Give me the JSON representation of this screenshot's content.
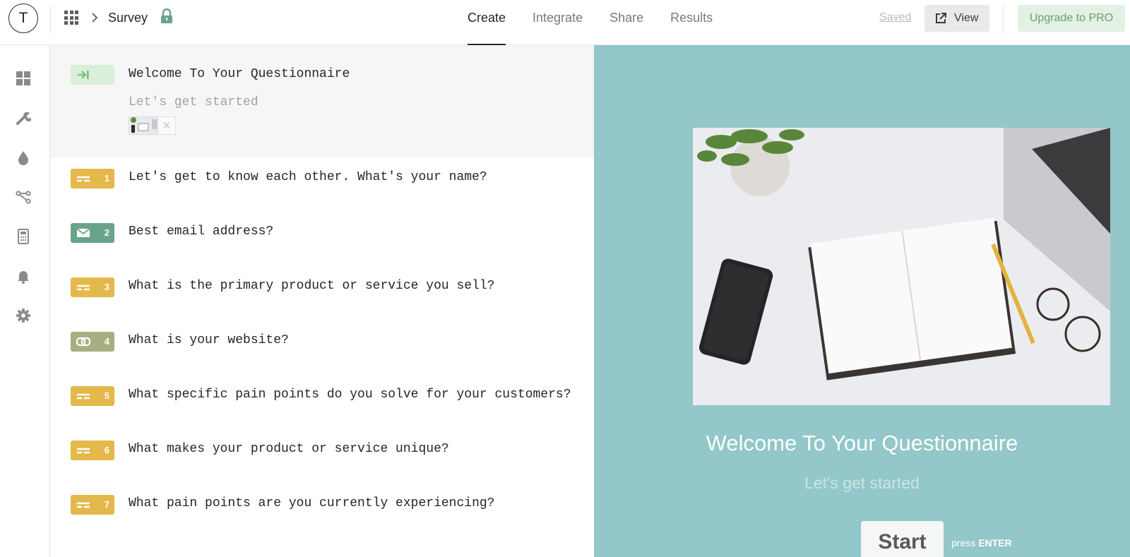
{
  "header": {
    "avatar_letter": "T",
    "breadcrumb_title": "Survey",
    "tabs": [
      {
        "label": "Create",
        "active": true
      },
      {
        "label": "Integrate",
        "active": false
      },
      {
        "label": "Share",
        "active": false
      },
      {
        "label": "Results",
        "active": false
      }
    ],
    "saved_label": "Saved",
    "view_label": "View",
    "upgrade_label": "Upgrade to PRO"
  },
  "sidebar": {
    "icons": [
      "dashboard-icon",
      "wrench-icon",
      "droplet-icon",
      "logic-icon",
      "calculator-icon",
      "bell-icon",
      "gear-icon"
    ]
  },
  "welcome_screen": {
    "title": "Welcome To Your Questionnaire",
    "subtitle": "Let's get started",
    "icon": "welcome-enter-icon",
    "color": "#d9efd8"
  },
  "questions": [
    {
      "number": "1",
      "text": "Let's get to know each other. What's your name?",
      "type_icon": "short-text-icon",
      "color": "#e4b84a"
    },
    {
      "number": "2",
      "text": "Best email address?",
      "type_icon": "email-icon",
      "color": "#6aa38b"
    },
    {
      "number": "3",
      "text": "What is the primary product or service you sell?",
      "type_icon": "short-text-icon",
      "color": "#e4b84a"
    },
    {
      "number": "4",
      "text": "What is your website?",
      "type_icon": "link-icon",
      "color": "#a9ad82"
    },
    {
      "number": "5",
      "text": "What specific pain points do you solve for your customers?",
      "type_icon": "short-text-icon",
      "color": "#e4b84a"
    },
    {
      "number": "6",
      "text": "What makes your product or service unique?",
      "type_icon": "short-text-icon",
      "color": "#e4b84a"
    },
    {
      "number": "7",
      "text": "What pain points are you currently experiencing?",
      "type_icon": "short-text-icon",
      "color": "#e4b84a"
    }
  ],
  "preview": {
    "title": "Welcome To Your Questionnaire",
    "subtitle": "Let's get started",
    "start_label": "Start",
    "press_label": "press",
    "press_key": "ENTER",
    "background": "#93c7c9"
  }
}
